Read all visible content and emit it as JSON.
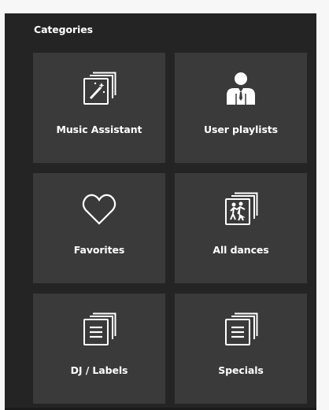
{
  "header": {
    "title": "Categories"
  },
  "tiles": [
    {
      "label": "Music Assistant",
      "icon": "magic-wand-card-icon"
    },
    {
      "label": "User playlists",
      "icon": "person-icon"
    },
    {
      "label": "Favorites",
      "icon": "heart-icon"
    },
    {
      "label": "All dances",
      "icon": "dancers-card-icon"
    },
    {
      "label": "DJ / Labels",
      "icon": "document-list-icon"
    },
    {
      "label": "Specials",
      "icon": "document-list-icon"
    }
  ],
  "colors": {
    "panel": "#242424",
    "tile": "#3a3a3a",
    "text": "#ffffff"
  }
}
